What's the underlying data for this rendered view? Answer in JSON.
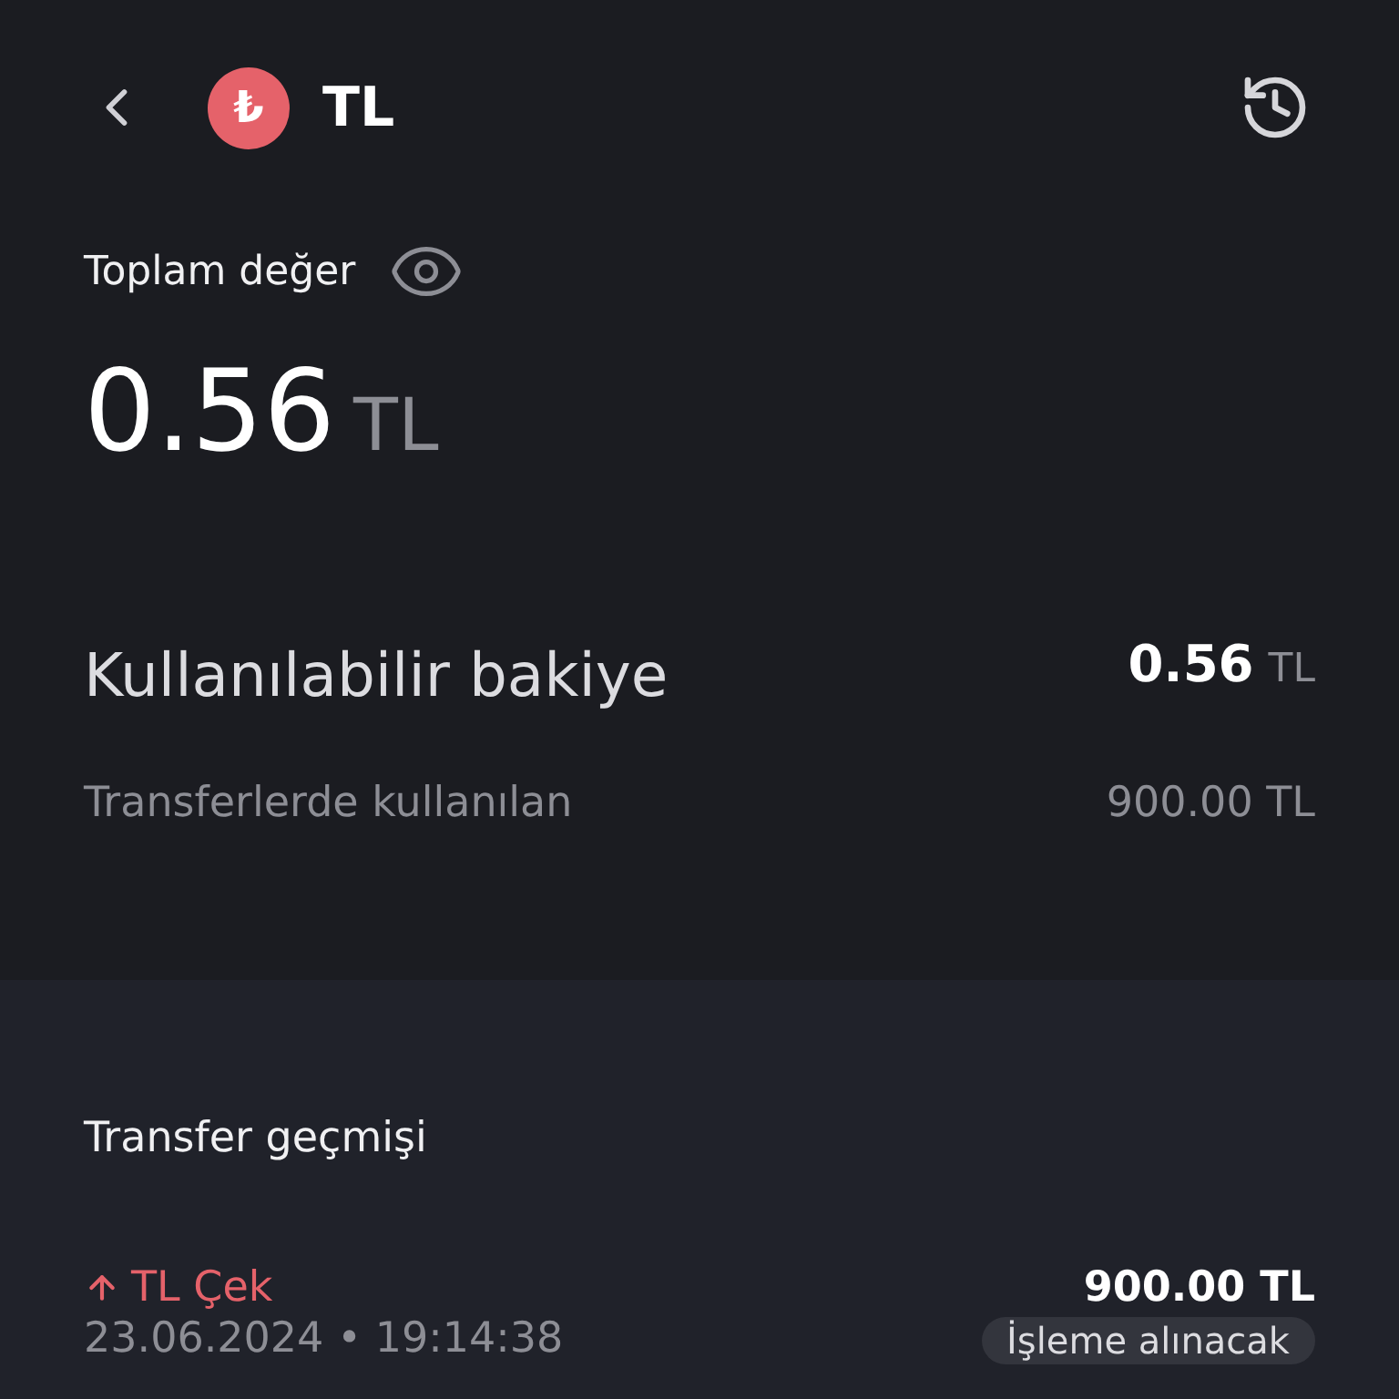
{
  "header": {
    "currency_symbol": "₺",
    "title": "TL"
  },
  "total": {
    "label": "Toplam değer",
    "amount": "0.56",
    "unit": "TL"
  },
  "balances": [
    {
      "kind": "main",
      "label": "Kullanılabilir bakiye",
      "amount": "0.56",
      "unit": "TL"
    },
    {
      "kind": "minor",
      "label": "Transferlerde kullanılan",
      "amount": "900.00 TL"
    }
  ],
  "history": {
    "title": "Transfer geçmişi",
    "items": [
      {
        "kind": "withdrawal",
        "title": "TL Çek",
        "time": "23.06.2024 • 19:14:38",
        "amount": "900.00 TL",
        "status": "İşleme alınacak"
      }
    ]
  }
}
